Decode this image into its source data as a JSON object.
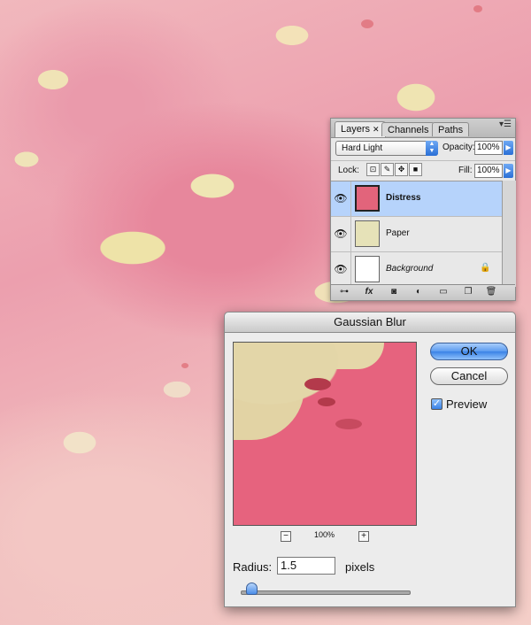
{
  "layers_panel": {
    "tabs": [
      {
        "label": "Layers",
        "active": true,
        "close": "✕"
      },
      {
        "label": "Channels",
        "active": false
      },
      {
        "label": "Paths",
        "active": false
      }
    ],
    "blend_mode": "Hard Light",
    "opacity_label": "Opacity:",
    "opacity_value": "100%",
    "lock_label": "Lock:",
    "fill_label": "Fill:",
    "fill_value": "100%",
    "layers": [
      {
        "name": "Distress",
        "selected": true
      },
      {
        "name": "Paper",
        "selected": false
      },
      {
        "name": "Background",
        "selected": false,
        "locked": true
      }
    ],
    "footer_icons": [
      "link-icon",
      "fx-icon",
      "mask-icon",
      "adjustment-icon",
      "folder-icon",
      "new-layer-icon",
      "trash-icon"
    ],
    "fx_label": "fx"
  },
  "gaussian_blur": {
    "title": "Gaussian Blur",
    "ok_label": "OK",
    "cancel_label": "Cancel",
    "preview_label": "Preview",
    "preview_checked": true,
    "zoom_minus": "−",
    "zoom_plus": "+",
    "zoom_level": "100%",
    "radius_label": "Radius:",
    "radius_value": "1.5",
    "radius_unit": "pixels"
  },
  "colors": {
    "canvas_pink": "#ec9fae",
    "paper_cream": "#efe4b2",
    "selected_row": "#b6d3fb",
    "aqua_blue": "#3a82e6"
  }
}
